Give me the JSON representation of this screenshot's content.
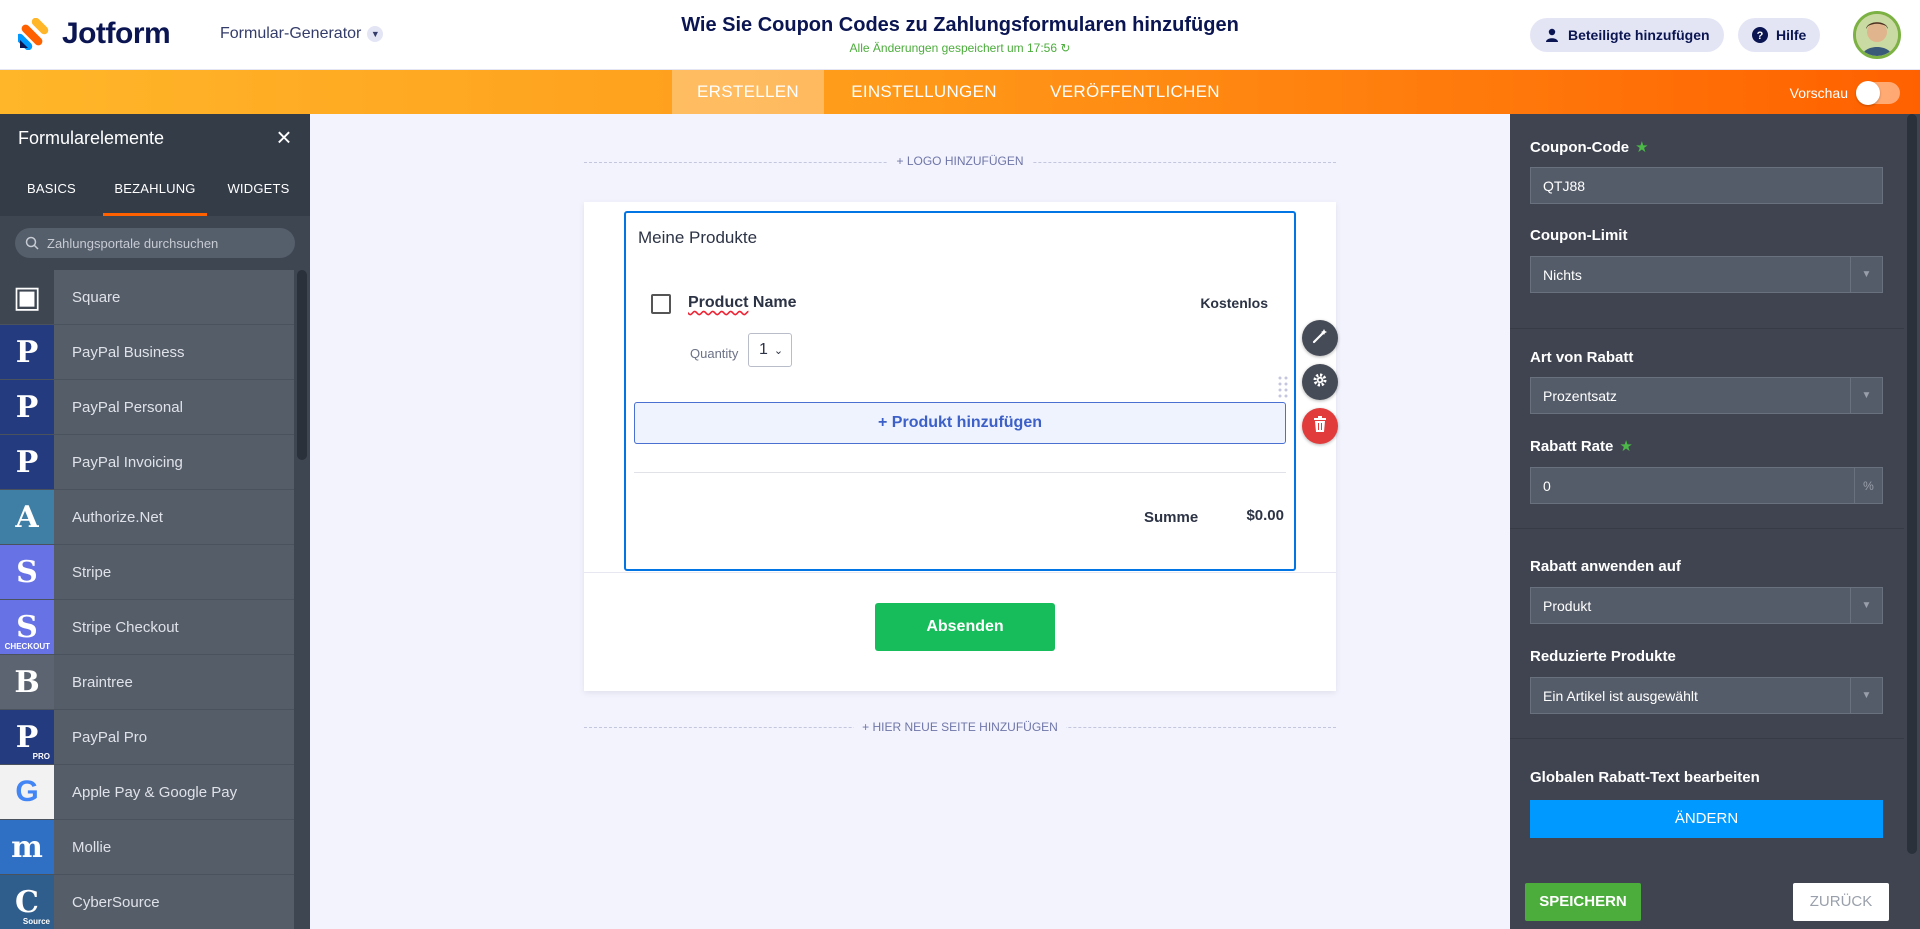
{
  "header": {
    "logo_text": "Jotform",
    "form_generator": "Formular-Generator",
    "title": "Wie Sie Coupon Codes zu Zahlungsformularen hinzufügen",
    "saved_status": "Alle Änderungen gespeichert um 17:56",
    "invite_label": "Beteiligte hinzufügen",
    "help_label": "Hilfe"
  },
  "nav": {
    "tabs": [
      {
        "label": "ERSTELLEN",
        "active": true
      },
      {
        "label": "EINSTELLUNGEN",
        "active": false
      },
      {
        "label": "VERÖFFENTLICHEN",
        "active": false
      }
    ],
    "preview_label": "Vorschau",
    "preview_on": false
  },
  "left_panel": {
    "title": "Formularelemente",
    "tabs": [
      {
        "label": "BASICS",
        "active": false
      },
      {
        "label": "BEZAHLUNG",
        "active": true
      },
      {
        "label": "WIDGETS",
        "active": false
      }
    ],
    "search_placeholder": "Zahlungsportale durchsuchen",
    "items": [
      {
        "label": "Square",
        "icon": "square-icon",
        "glyph": "▣",
        "color": "#3e4652"
      },
      {
        "label": "PayPal Business",
        "icon": "paypal-business-icon",
        "glyph": "P",
        "color": "#253b80"
      },
      {
        "label": "PayPal Personal",
        "icon": "paypal-personal-icon",
        "glyph": "P",
        "color": "#253b80"
      },
      {
        "label": "PayPal Invoicing",
        "icon": "paypal-invoicing-icon",
        "glyph": "P",
        "color": "#253b80"
      },
      {
        "label": "Authorize.Net",
        "icon": "authorize-net-icon",
        "glyph": "A",
        "color": "#3f7fa6"
      },
      {
        "label": "Stripe",
        "icon": "stripe-icon",
        "glyph": "S",
        "color": "#6772e5"
      },
      {
        "label": "Stripe Checkout",
        "icon": "stripe-checkout-icon",
        "glyph": "S",
        "color": "#6772e5",
        "sub": "CHECKOUT"
      },
      {
        "label": "Braintree",
        "icon": "braintree-icon",
        "glyph": "B",
        "color": "#5b6470"
      },
      {
        "label": "PayPal Pro",
        "icon": "paypal-pro-icon",
        "glyph": "P",
        "color": "#253b80",
        "sub": "PRO"
      },
      {
        "label": "Apple Pay & Google Pay",
        "icon": "apple-google-pay-icon",
        "glyph": "G",
        "color": "#f2f2f2"
      },
      {
        "label": "Mollie",
        "icon": "mollie-icon",
        "glyph": "m",
        "color": "#2f6fc4"
      },
      {
        "label": "CyberSource",
        "icon": "cybersource-icon",
        "glyph": "C",
        "color": "#2f5d8c",
        "sub": "Source"
      }
    ]
  },
  "canvas": {
    "add_logo": "+ LOGO HINZUFÜGEN",
    "widget_title": "Meine Produkte",
    "product_name_a": "Product",
    "product_name_b": " Name",
    "product_price": "Kostenlos",
    "quantity_label": "Quantity",
    "quantity_value": "1",
    "add_product": "+ Produkt hinzufügen",
    "total_label": "Summe",
    "total_value": "$0.00",
    "submit": "Absenden",
    "add_page": "+ HIER NEUE SEITE HINZUFÜGEN"
  },
  "right_panel": {
    "coupon_code_label": "Coupon-Code",
    "coupon_code_value": "QTJ88",
    "coupon_limit_label": "Coupon-Limit",
    "coupon_limit_value": "Nichts",
    "discount_type_label": "Art von Rabatt",
    "discount_type_value": "Prozentsatz",
    "rate_label": "Rabatt Rate",
    "rate_value": "0",
    "rate_unit": "%",
    "apply_to_label": "Rabatt anwenden auf",
    "apply_to_value": "Produkt",
    "reduced_label": "Reduzierte Produkte",
    "reduced_value": "Ein Artikel ist ausgewählt",
    "global_text_label": "Globalen Rabatt-Text bearbeiten",
    "change_button": "ÄNDERN",
    "save_button": "SPEICHERN",
    "back_button": "ZURÜCK"
  },
  "colors": {
    "accent_orange": "#ff6100",
    "green": "#18bd5b",
    "blue": "#0099ff",
    "panel_dark": "#3e4652"
  }
}
